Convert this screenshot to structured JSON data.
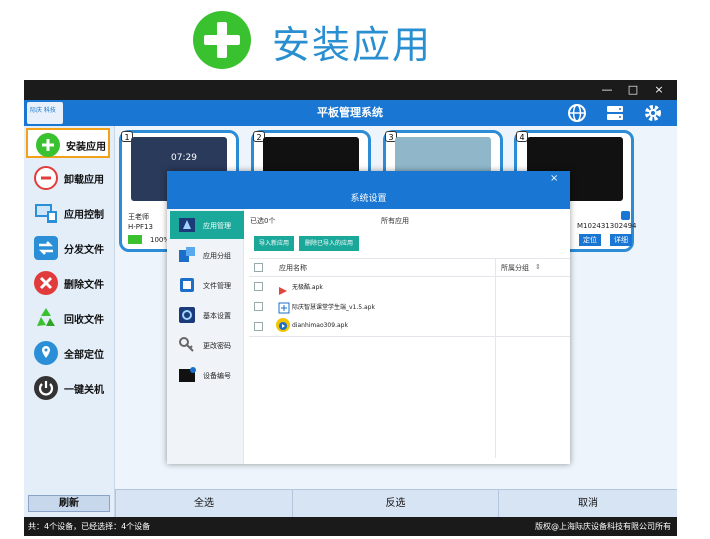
{
  "header": {
    "title": "安装应用"
  },
  "window": {
    "title": "平板管理系统",
    "controls": [
      "—",
      "□",
      "×"
    ],
    "logo_text": "际庆 科技"
  },
  "sidebar": {
    "items": [
      {
        "label": "安装应用",
        "icon": "plus-icon",
        "color": "#3ac12f"
      },
      {
        "label": "卸载应用",
        "icon": "minus-icon",
        "color": "#e23b3b"
      },
      {
        "label": "应用控制",
        "icon": "monitor-icon",
        "color": "#2b8fd8"
      },
      {
        "label": "分发文件",
        "icon": "swap-icon",
        "color": "#2b8fd8"
      },
      {
        "label": "删除文件",
        "icon": "delete-icon",
        "color": "#e23b3b"
      },
      {
        "label": "回收文件",
        "icon": "recycle-icon",
        "color": "#3ac12f"
      },
      {
        "label": "全部定位",
        "icon": "location-icon",
        "color": "#2b8fd8"
      },
      {
        "label": "一键关机",
        "icon": "power-icon",
        "color": "#333333"
      }
    ],
    "refresh": "刷新"
  },
  "devices": [
    {
      "num": "1",
      "user": "王老师",
      "model": "H-PF13",
      "battery": "100%",
      "time": "07:29"
    },
    {
      "num": "2"
    },
    {
      "num": "3"
    },
    {
      "num": "4",
      "model": "M102431302494",
      "locate": "定位",
      "detail": "详细"
    }
  ],
  "bottom": {
    "select_all": "全选",
    "invert": "反选",
    "cancel": "取消"
  },
  "status": {
    "left": "共：4个设备，已经选择：4个设备",
    "right": "版权@上海际庆设备科技有限公司所有"
  },
  "dialog": {
    "title": "系统设置",
    "close": "×",
    "nav": [
      {
        "label": "应用管理",
        "active": true
      },
      {
        "label": "应用分组"
      },
      {
        "label": "文件管理"
      },
      {
        "label": "基本设置"
      },
      {
        "label": "更改密码"
      },
      {
        "label": "设备编号"
      }
    ],
    "selected_count": "已选0个",
    "filter": "所有应用",
    "btn_import": "导入新应用",
    "btn_delete": "删除已导入的应用",
    "col_name": "应用名称",
    "col_group": "所属分组",
    "sort_icon": "⇕",
    "apps": [
      {
        "name": "无极酷.apk"
      },
      {
        "name": "际庆智慧课堂学生端_v1.5.apk"
      },
      {
        "name": "dianhimao309.apk"
      }
    ]
  }
}
